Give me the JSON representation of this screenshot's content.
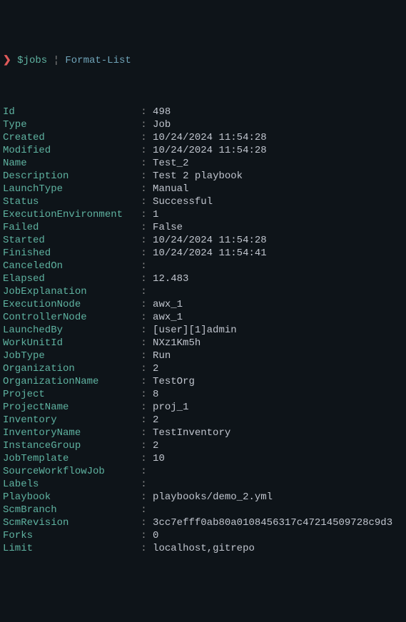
{
  "prompt": {
    "arrow": "❯",
    "var": "$jobs",
    "pipe": "¦",
    "cmd": "Format-List"
  },
  "fields": [
    {
      "key": "Id",
      "value": "498"
    },
    {
      "key": "Type",
      "value": "Job"
    },
    {
      "key": "Created",
      "value": "10/24/2024 11:54:28"
    },
    {
      "key": "Modified",
      "value": "10/24/2024 11:54:28"
    },
    {
      "key": "Name",
      "value": "Test_2"
    },
    {
      "key": "Description",
      "value": "Test 2 playbook"
    },
    {
      "key": "LaunchType",
      "value": "Manual"
    },
    {
      "key": "Status",
      "value": "Successful"
    },
    {
      "key": "ExecutionEnvironment",
      "value": "1"
    },
    {
      "key": "Failed",
      "value": "False"
    },
    {
      "key": "Started",
      "value": "10/24/2024 11:54:28"
    },
    {
      "key": "Finished",
      "value": "10/24/2024 11:54:41"
    },
    {
      "key": "CanceledOn",
      "value": ""
    },
    {
      "key": "Elapsed",
      "value": "12.483"
    },
    {
      "key": "JobExplanation",
      "value": ""
    },
    {
      "key": "ExecutionNode",
      "value": "awx_1"
    },
    {
      "key": "ControllerNode",
      "value": "awx_1"
    },
    {
      "key": "LaunchedBy",
      "value": "[user][1]admin"
    },
    {
      "key": "WorkUnitId",
      "value": "NXz1Km5h"
    },
    {
      "key": "JobType",
      "value": "Run"
    },
    {
      "key": "Organization",
      "value": "2"
    },
    {
      "key": "OrganizationName",
      "value": "TestOrg"
    },
    {
      "key": "Project",
      "value": "8"
    },
    {
      "key": "ProjectName",
      "value": "proj_1"
    },
    {
      "key": "Inventory",
      "value": "2"
    },
    {
      "key": "InventoryName",
      "value": "TestInventory"
    },
    {
      "key": "InstanceGroup",
      "value": "2"
    },
    {
      "key": "JobTemplate",
      "value": "10"
    },
    {
      "key": "SourceWorkflowJob",
      "value": ""
    },
    {
      "key": "Labels",
      "value": ""
    },
    {
      "key": "Playbook",
      "value": "playbooks/demo_2.yml"
    },
    {
      "key": "ScmBranch",
      "value": ""
    },
    {
      "key": "ScmRevision",
      "value": "3cc7efff0ab80a0108456317c47214509728c9d3"
    },
    {
      "key": "Forks",
      "value": "0"
    },
    {
      "key": "Limit",
      "value": "localhost,gitrepo"
    }
  ],
  "keyWidth": 23
}
